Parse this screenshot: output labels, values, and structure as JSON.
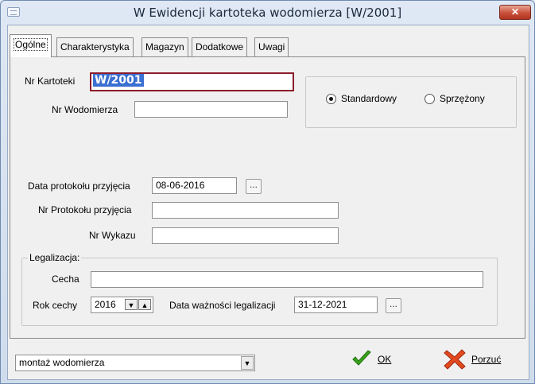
{
  "window": {
    "title": "W Ewidencji kartoteka wodomierza [W/2001]",
    "close_symbol": "✕"
  },
  "tabs": [
    {
      "label": "Ogólne",
      "active": true
    },
    {
      "label": "Charakterystyka",
      "active": false
    },
    {
      "label": "Magazyn",
      "active": false
    },
    {
      "label": "Dodatkowe",
      "active": false
    },
    {
      "label": "Uwagi",
      "active": false
    }
  ],
  "form": {
    "nr_kartoteki": {
      "label": "Nr Kartoteki",
      "value": "W/2001"
    },
    "nr_wodomierza": {
      "label": "Nr Wodomierza",
      "value": ""
    },
    "type_options": [
      {
        "label": "Standardowy",
        "selected": true
      },
      {
        "label": "Sprzężony",
        "selected": false
      }
    ],
    "data_protokolu": {
      "label": "Data protokołu przyjęcia",
      "value": "08-06-2016"
    },
    "nr_protokolu": {
      "label": "Nr Protokołu przyjęcia",
      "value": ""
    },
    "nr_wykazu": {
      "label": "Nr Wykazu",
      "value": ""
    },
    "ellipsis": "...",
    "legalizacja": {
      "legend": "Legalizacja:",
      "cecha_label": "Cecha",
      "cecha_value": "",
      "rok_cechy_label": "Rok cechy",
      "rok_cechy_value": "2016",
      "spin_down": "▼",
      "spin_up": "▲",
      "data_waznosci_label": "Data ważności legalizacji",
      "data_waznosci_value": "31-12-2021"
    }
  },
  "footer": {
    "action_select": {
      "value": "montaż wodomierza",
      "arrow": "▼"
    },
    "ok": {
      "label": "OK",
      "accent": "#2d8a17"
    },
    "cancel": {
      "label": "Porzuć",
      "accent": "#d53a1a"
    }
  }
}
